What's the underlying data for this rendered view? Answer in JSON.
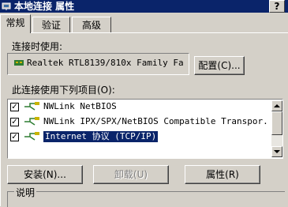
{
  "window": {
    "title": "本地连接 属性",
    "help_button": "?"
  },
  "tabs": [
    {
      "label": "常规",
      "active": true
    },
    {
      "label": "验证",
      "active": false
    },
    {
      "label": "高级",
      "active": false
    }
  ],
  "connect_using": {
    "label": "连接时使用:",
    "adapter": "Realtek RTL8139/810x Family Fa",
    "configure_button": "配置(C)..."
  },
  "components": {
    "label": "此连接使用下列项目(O):",
    "items": [
      {
        "label": "NWLink NetBIOS",
        "checked": true,
        "selected": false
      },
      {
        "label": "NWLink IPX/SPX/NetBIOS Compatible Transpor.",
        "checked": true,
        "selected": false
      },
      {
        "label": "Internet 协议 (TCP/IP)",
        "checked": true,
        "selected": true
      }
    ]
  },
  "buttons": {
    "install": "安装(N)...",
    "uninstall": "卸载(U)",
    "properties": "属性(R)"
  },
  "description": {
    "label": "说明"
  },
  "colors": {
    "titlebar": "#0a246a",
    "face": "#d4d0c8",
    "selection": "#0a246a"
  }
}
